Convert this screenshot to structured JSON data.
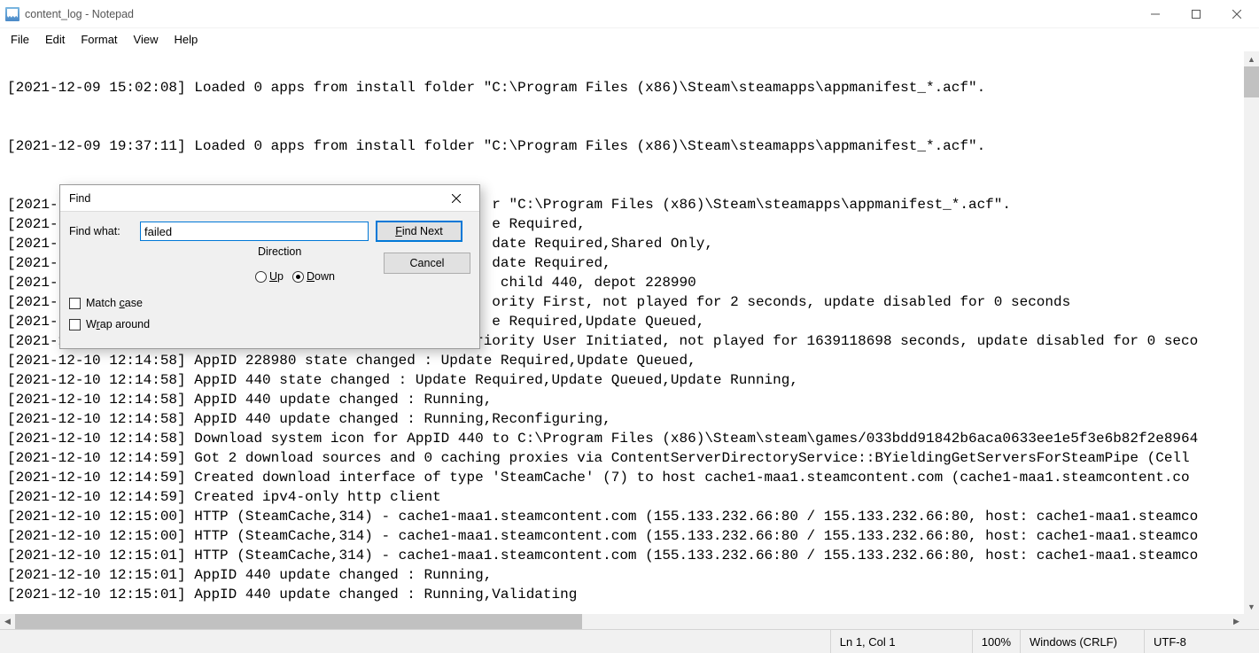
{
  "title": "content_log - Notepad",
  "menu": {
    "file": "File",
    "edit": "Edit",
    "format": "Format",
    "view": "View",
    "help": "Help"
  },
  "editor_text": "\n[2021-12-09 15:02:08] Loaded 0 apps from install folder \"C:\\Program Files (x86)\\Steam\\steamapps\\appmanifest_*.acf\".\n\n\n[2021-12-09 19:37:11] Loaded 0 apps from install folder \"C:\\Program Files (x86)\\Steam\\steamapps\\appmanifest_*.acf\".\n\n\n[2021-                                                   r \"C:\\Program Files (x86)\\Steam\\steamapps\\appmanifest_*.acf\".\n[2021-                                                   e Required,\n[2021-                                                   date Required,Shared Only,\n[2021-                                                   date Required,\n[2021-                                                    child 440, depot 228990\n[2021-                                                   ority First, not played for 2 seconds, update disabled for 0 seconds\n[2021-                                                   e Required,Update Queued,\n[2021-12-10 12:14:58] AppID 228980 scheduler update : Priority User Initiated, not played for 1639118698 seconds, update disabled for 0 seco\n[2021-12-10 12:14:58] AppID 228980 state changed : Update Required,Update Queued,\n[2021-12-10 12:14:58] AppID 440 state changed : Update Required,Update Queued,Update Running,\n[2021-12-10 12:14:58] AppID 440 update changed : Running,\n[2021-12-10 12:14:58] AppID 440 update changed : Running,Reconfiguring,\n[2021-12-10 12:14:58] Download system icon for AppID 440 to C:\\Program Files (x86)\\Steam\\steam\\games/033bdd91842b6aca0633ee1e5f3e6b82f2e8964\n[2021-12-10 12:14:59] Got 2 download sources and 0 caching proxies via ContentServerDirectoryService::BYieldingGetServersForSteamPipe (Cell\n[2021-12-10 12:14:59] Created download interface of type 'SteamCache' (7) to host cache1-maa1.steamcontent.com (cache1-maa1.steamcontent.co\n[2021-12-10 12:14:59] Created ipv4-only http client\n[2021-12-10 12:15:00] HTTP (SteamCache,314) - cache1-maa1.steamcontent.com (155.133.232.66:80 / 155.133.232.66:80, host: cache1-maa1.steamco\n[2021-12-10 12:15:00] HTTP (SteamCache,314) - cache1-maa1.steamcontent.com (155.133.232.66:80 / 155.133.232.66:80, host: cache1-maa1.steamco\n[2021-12-10 12:15:01] HTTP (SteamCache,314) - cache1-maa1.steamcontent.com (155.133.232.66:80 / 155.133.232.66:80, host: cache1-maa1.steamco\n[2021-12-10 12:15:01] AppID 440 update changed : Running,\n[2021-12-10 12:15:01] AppID 440 update changed : Running,Validating",
  "find": {
    "title": "Find",
    "what_label": "Find what:",
    "what_value": "failed",
    "find_next": "Find Next",
    "cancel": "Cancel",
    "direction": "Direction",
    "up": "Up",
    "down": "Down",
    "match_case": "Match case",
    "wrap": "Wrap around"
  },
  "status": {
    "pos": "Ln 1, Col 1",
    "zoom": "100%",
    "eol": "Windows (CRLF)",
    "enc": "UTF-8"
  }
}
